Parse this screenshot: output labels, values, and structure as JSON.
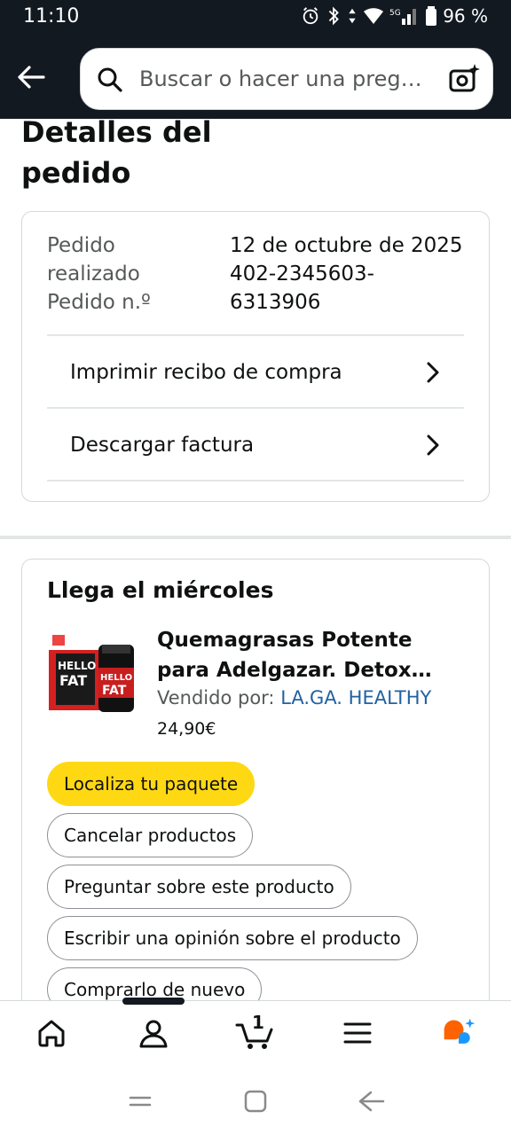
{
  "status_bar": {
    "time": "11:10",
    "battery": "96 %"
  },
  "header": {
    "search_placeholder": "Buscar o hacer una pregunta",
    "icons": [
      "back-arrow-icon",
      "search-icon",
      "camera-search-icon"
    ]
  },
  "page": {
    "title_line1": "Detalles del",
    "title_line2": "pedido"
  },
  "order": {
    "placed_label_line1": "Pedido",
    "placed_label_line2": "realizado",
    "number_label": "Pedido n.º",
    "placed_date": "12 de octubre de 2025",
    "number_line1": "402-2345603-",
    "number_line2": "6313906",
    "links": [
      {
        "label": "Imprimir recibo de compra"
      },
      {
        "label": "Descargar factura"
      }
    ]
  },
  "delivery": {
    "title": "Llega el miércoles",
    "product": {
      "title": "Quemagrasas Potente para Adelgazar. Detox Adelgazante",
      "sold_by_label": "Vendido por: ",
      "seller": "LA.GA. HEALTHY",
      "price": "24,90€",
      "image_brand_text": "HELLO FAT"
    },
    "actions": [
      {
        "label": "Localiza tu paquete",
        "primary": true
      },
      {
        "label": "Cancelar productos",
        "primary": false
      },
      {
        "label": "Preguntar sobre este producto",
        "primary": false
      },
      {
        "label": "Escribir una opinión sobre el producto",
        "primary": false
      },
      {
        "label": "Comprarlo de nuevo",
        "primary": false
      }
    ]
  },
  "bottom_nav": {
    "cart_count": "1",
    "items": [
      "home-icon",
      "account-icon",
      "cart-icon",
      "menu-icon",
      "rufus-ai-icon"
    ]
  },
  "colors": {
    "header_bg": "#131921",
    "primary_button": "#ffd814",
    "link": "#2162a1",
    "ai_orange": "#ff6200",
    "ai_blue": "#1a98ff"
  }
}
